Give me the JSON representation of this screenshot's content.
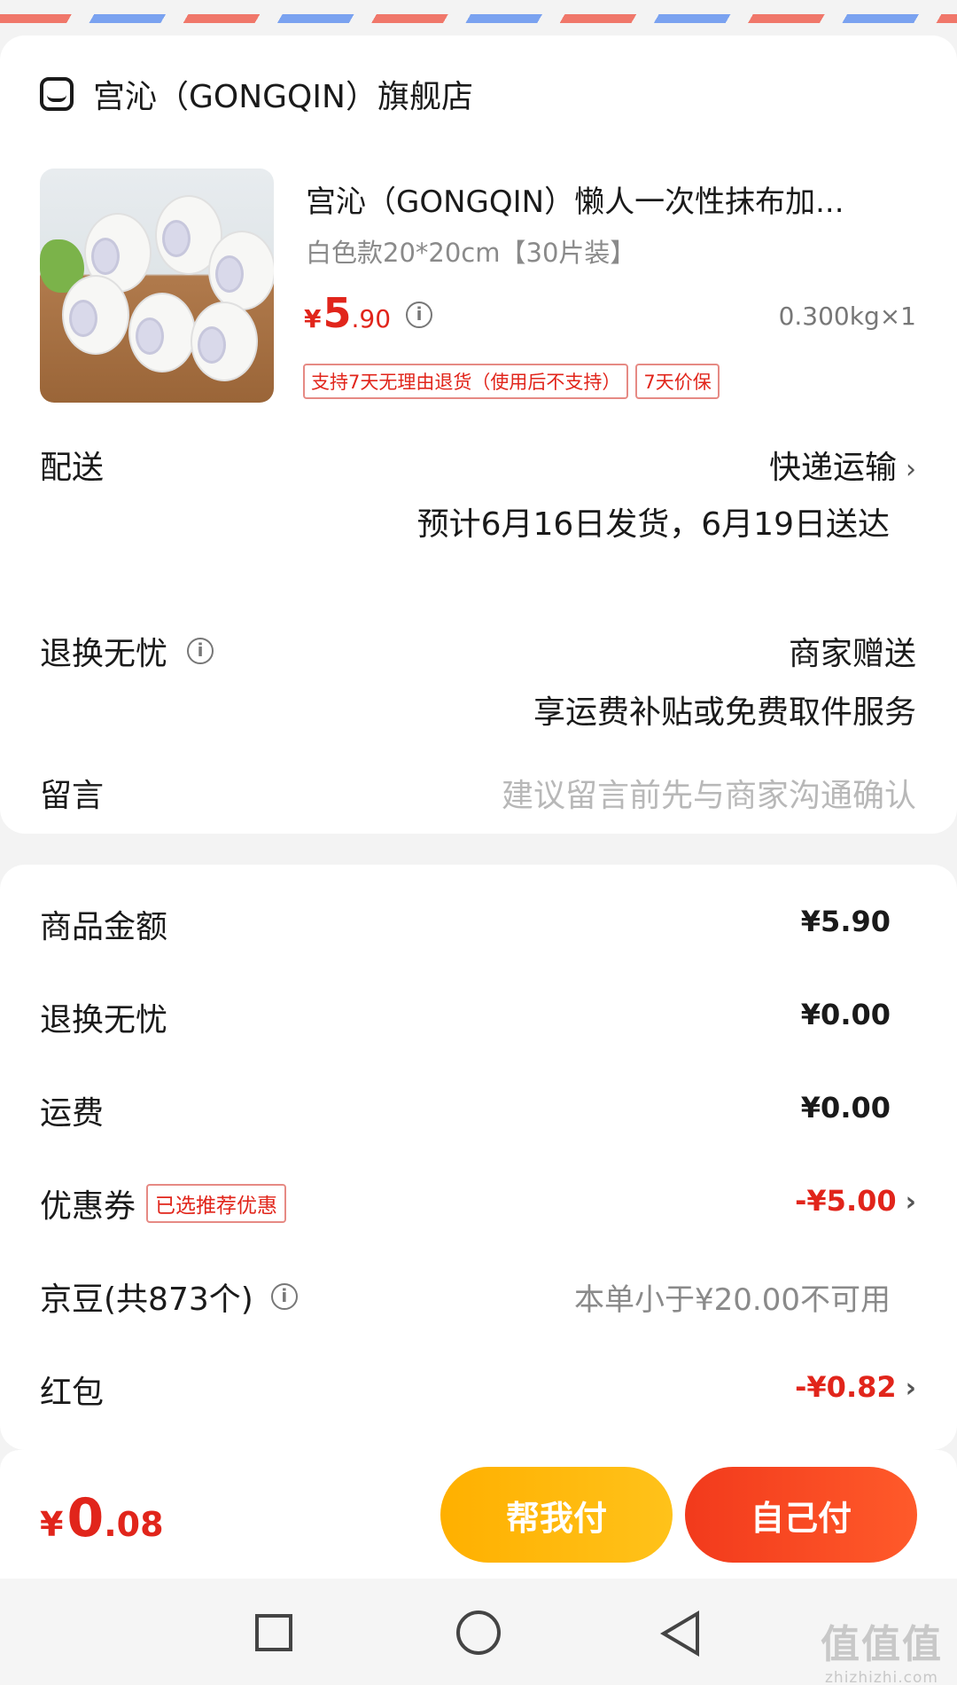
{
  "shop": {
    "name": "宫沁（GONGQIN）旗舰店",
    "icon": "shop-icon"
  },
  "product": {
    "title": "宫沁（GONGQIN）懒人一次性抹布加...",
    "spec": "白色款20*20cm【30片装】",
    "price_currency": "¥",
    "price_int": "5",
    "price_dec": ".90",
    "weight": "0.300kg×1",
    "tags": [
      "支持7天无理由退货（使用后不支持）",
      "7天价保"
    ]
  },
  "delivery": {
    "label": "配送",
    "method": "快递运输",
    "estimate": "预计6月16日发货，6月19日送达"
  },
  "return_service": {
    "label": "退换无忧",
    "value": "商家赠送",
    "desc": "享运费补贴或免费取件服务"
  },
  "message": {
    "label": "留言",
    "placeholder": "建议留言前先与商家沟通确认"
  },
  "summary": {
    "goods_label": "商品金额",
    "goods_value": "¥5.90",
    "return_label": "退换无忧",
    "return_value": "¥0.00",
    "shipping_label": "运费",
    "shipping_value": "¥0.00",
    "coupon_label": "优惠券",
    "coupon_tag": "已选推荐优惠",
    "coupon_value": "-¥5.00",
    "beans_label": "京豆(共873个)",
    "beans_value": "本单小于¥20.00不可用",
    "redpacket_label": "红包",
    "redpacket_value": "-¥0.82"
  },
  "bottom": {
    "total_currency": "¥",
    "total_int": "0",
    "total_dec": ".08",
    "help_pay": "帮我付",
    "self_pay": "自己付"
  },
  "watermark": {
    "big": "值值值",
    "small": "zhizhizhi.com"
  },
  "colors": {
    "accent_red": "#e1251b",
    "help_btn": "#ffb000",
    "self_btn": "#f23a1c"
  }
}
